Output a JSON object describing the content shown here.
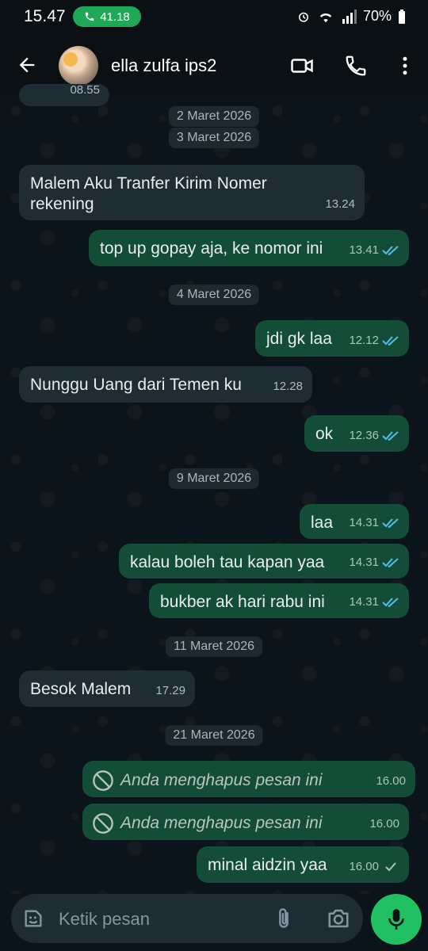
{
  "status": {
    "time": "15.47",
    "call_timer": "41.18",
    "battery": "70%"
  },
  "header": {
    "contact_name": "ella zulfa ips2"
  },
  "messages": {
    "partial_time": "08.55",
    "d1": "2 Maret 2026",
    "d2": "3 Maret 2026",
    "m1_line1": "Malem Aku Tranfer Kirim Nomer",
    "m1_line2": "rekening",
    "m1_time": "13.24",
    "m2": "top up gopay aja, ke nomor ini",
    "m2_time": "13.41",
    "d3": "4 Maret 2026",
    "m3": "jdi gk laa",
    "m3_time": "12.12",
    "m4": "Nunggu Uang dari Temen ku",
    "m4_time": "12.28",
    "m5": "ok",
    "m5_time": "12.36",
    "d4": "9 Maret 2026",
    "m6": "laa",
    "m6_time": "14.31",
    "m7": "kalau boleh tau kapan yaa",
    "m7_time": "14.31",
    "m8": "bukber ak hari rabu ini",
    "m8_time": "14.31",
    "d5": "11 Maret 2026",
    "m9": "Besok Malem",
    "m9_time": "17.29",
    "d6": "21 Maret 2026",
    "deleted_text": "Anda menghapus pesan ini",
    "m10_time": "16.00",
    "m11_time": "16.00",
    "m12": "minal aidzin yaa",
    "m12_time": "16.00"
  },
  "composer": {
    "placeholder": "Ketik pesan"
  },
  "colors": {
    "accent": "#21c063",
    "outgoing": "#144d37",
    "incoming": "#1f2c33",
    "read_tick": "#53bdeb"
  }
}
